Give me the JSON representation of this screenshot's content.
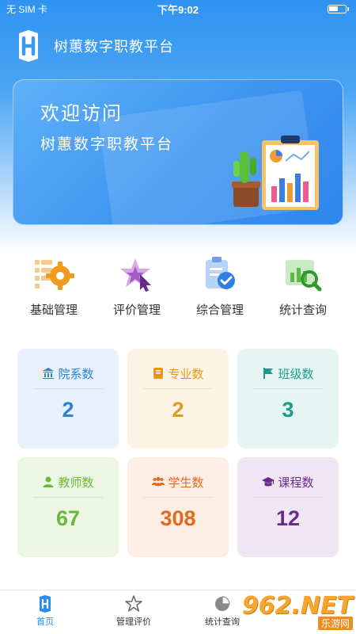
{
  "status_bar": {
    "carrier": "无 SIM 卡",
    "time": "下午9:02"
  },
  "header": {
    "title": "树蕙数字职教平台"
  },
  "banner": {
    "welcome": "欢迎访问",
    "subtitle": "树蕙数字职教平台"
  },
  "menu": [
    {
      "label": "基础管理",
      "icon": "gear-grid-icon"
    },
    {
      "label": "评价管理",
      "icon": "star-cursor-icon"
    },
    {
      "label": "综合管理",
      "icon": "clipboard-check-icon"
    },
    {
      "label": "统计查询",
      "icon": "chart-search-icon"
    }
  ],
  "stats": [
    {
      "label": "院系数",
      "value": "2",
      "icon": "building-icon",
      "color": "#2f7fd6",
      "bg": "#e6f1fd"
    },
    {
      "label": "专业数",
      "value": "2",
      "icon": "book-icon",
      "color": "#e39a1c",
      "bg": "#fdf3e4"
    },
    {
      "label": "班级数",
      "value": "3",
      "icon": "flag-icon",
      "color": "#1f9a8a",
      "bg": "#e4f5f2"
    },
    {
      "label": "教师数",
      "value": "67",
      "icon": "user-icon",
      "color": "#6db83a",
      "bg": "#ecf6e3"
    },
    {
      "label": "学生数",
      "value": "308",
      "icon": "users-icon",
      "color": "#e06a1f",
      "bg": "#fdeee4"
    },
    {
      "label": "课程数",
      "value": "12",
      "icon": "graduation-cap-icon",
      "color": "#6a2a8c",
      "bg": "#efe6f4"
    }
  ],
  "tabs": [
    {
      "label": "首页",
      "icon": "home-logo-icon",
      "active": true
    },
    {
      "label": "管理评价",
      "icon": "star-icon"
    },
    {
      "label": "统计查询",
      "icon": "pie-chart-icon"
    }
  ],
  "watermark": {
    "big": "962.NET",
    "small": "乐游网"
  }
}
